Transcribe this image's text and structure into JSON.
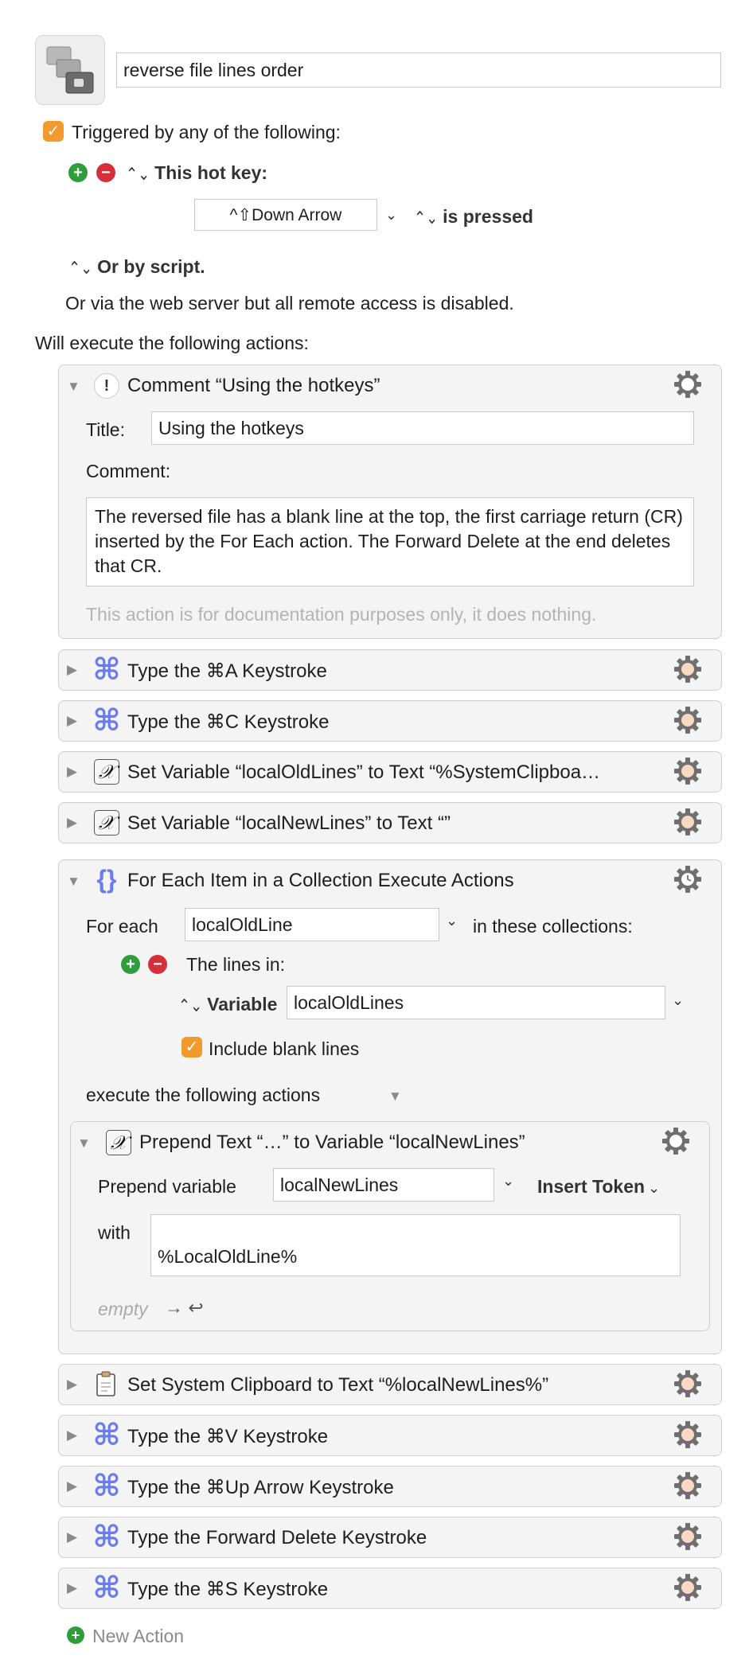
{
  "macro": {
    "name": "reverse file lines order",
    "triggered_label": "Triggered by any of the following:",
    "hotkey_label": "This hot key:",
    "hotkey_value": "^⇧Down Arrow",
    "hotkey_state": "is pressed",
    "script_label": "Or by script.",
    "webserver_text": "Or via the web server but all remote access is disabled.",
    "will_execute": "Will execute the following actions:"
  },
  "comment_action": {
    "title": "Comment “Using the hotkeys”",
    "title_label": "Title:",
    "title_value": "Using the hotkeys",
    "comment_label": "Comment:",
    "comment_text": "The reversed file has a blank line at the top, the first  carriage return (CR) inserted by the For Each action. The Forward Delete at the end deletes that CR.",
    "footer": "This action is for documentation purposes only, it does nothing."
  },
  "actions_top": [
    {
      "title": "Type the ⌘A Keystroke",
      "icon": "command-icon"
    },
    {
      "title": "Type the ⌘C Keystroke",
      "icon": "command-icon"
    },
    {
      "title": "Set Variable “localOldLines” to Text “%SystemClipboa…",
      "icon": "variable-icon"
    },
    {
      "title": "Set Variable “localNewLines” to Text “”",
      "icon": "variable-icon"
    }
  ],
  "foreach_action": {
    "title": "For Each Item in a Collection Execute Actions",
    "for_each_label": "For each",
    "for_each_value": "localOldLine",
    "in_collections": "in these collections:",
    "lines_in": "The lines in:",
    "variable_label": "Variable",
    "variable_value": "localOldLines",
    "include_blank": "Include blank lines",
    "execute_label": "execute the following actions"
  },
  "prepend_action": {
    "title": "Prepend Text “…” to Variable “localNewLines”",
    "prepend_label": "Prepend variable",
    "prepend_value": "localNewLines",
    "insert_token": "Insert Token",
    "with_label": "with",
    "with_value": "%LocalOldLine%",
    "empty_label": "empty",
    "empty_arrow": "→ ↩"
  },
  "actions_bottom": [
    {
      "title": "Set System Clipboard to Text “%localNewLines%”",
      "icon": "clipboard-icon"
    },
    {
      "title": "Type the ⌘V Keystroke",
      "icon": "command-icon"
    },
    {
      "title": "Type the ⌘Up Arrow Keystroke",
      "icon": "command-icon"
    },
    {
      "title": "Type the Forward Delete Keystroke",
      "icon": "command-icon"
    },
    {
      "title": "Type the ⌘S Keystroke",
      "icon": "command-icon"
    }
  ],
  "new_action": "New Action",
  "colors": {
    "accent_orange": "#f39a2e",
    "add_green": "#2e9d3a",
    "remove_red": "#d62f3a",
    "command_blue": "#6a7cf0"
  }
}
